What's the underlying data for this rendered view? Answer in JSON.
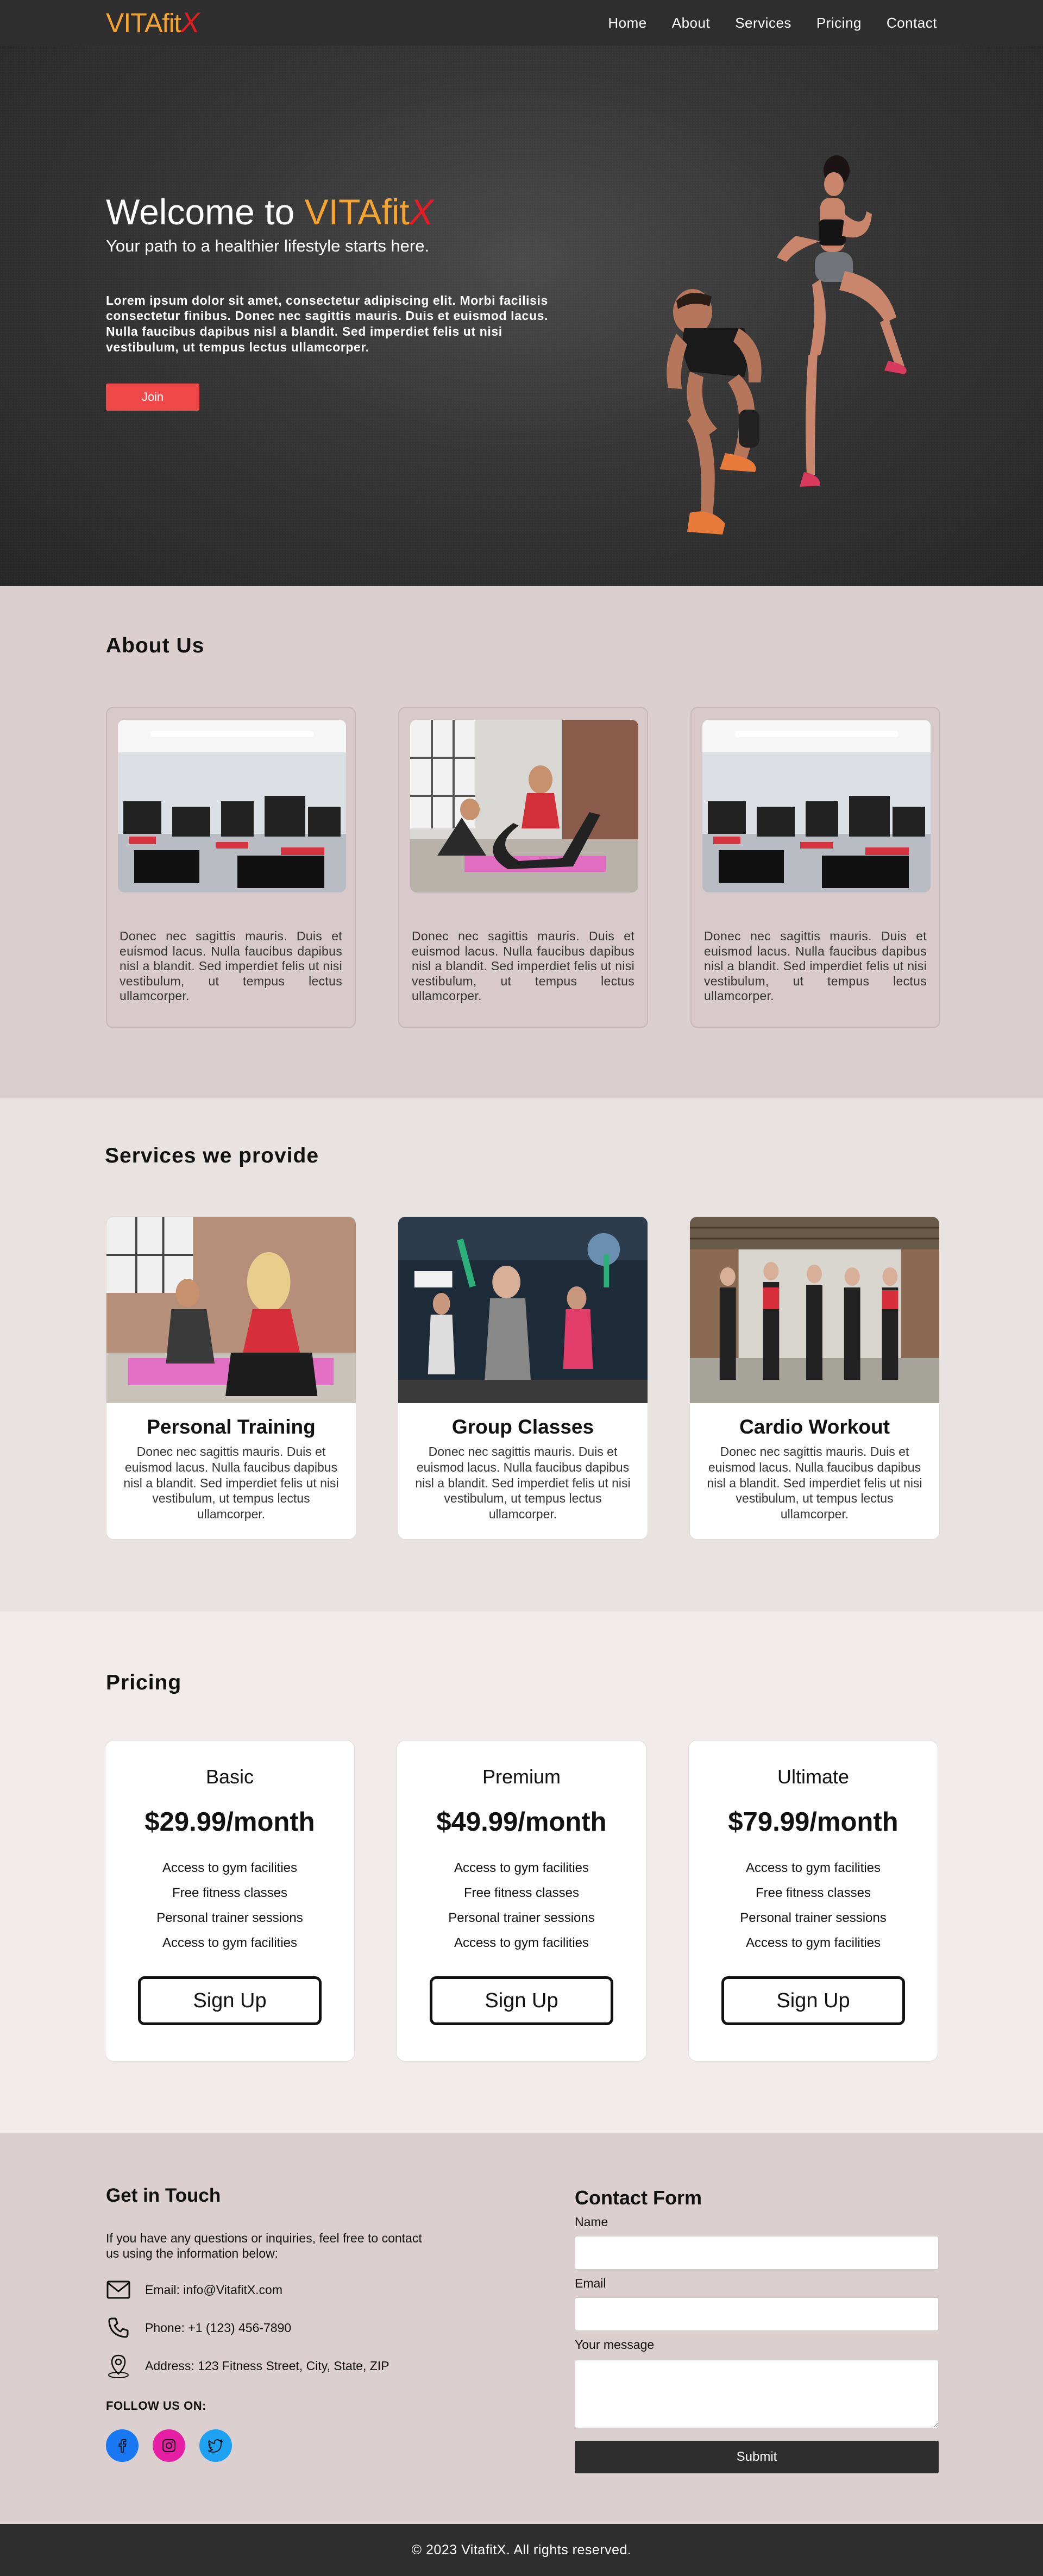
{
  "nav": {
    "logo_vita": "VITA",
    "logo_fit": "fit",
    "logo_x": "X",
    "links": [
      "Home",
      "About",
      "Services",
      "Pricing",
      "Contact"
    ]
  },
  "hero": {
    "title_prefix": "Welcome to",
    "title_vita": "VITA",
    "title_fit": "fit",
    "title_x": "X",
    "subtitle": "Your path to a healthier lifestyle starts here.",
    "body": "Lorem ipsum dolor sit amet, consectetur adipiscing elit. Morbi facilisis consectetur finibus. Donec nec sagittis mauris. Duis et euismod lacus. Nulla faucibus dapibus nisl a blandit. Sed imperdiet felis ut nisi vestibulum, ut tempus lectus ullamcorper.",
    "join_label": "Join"
  },
  "about": {
    "title": "About Us",
    "cards": [
      {
        "text": "Donec nec sagittis mauris. Duis et euismod lacus. Nulla faucibus dapibus nisl a blandit. Sed imperdiet felis ut nisi vestibulum, ut tempus lectus ullamcorper."
      },
      {
        "text": "Donec nec sagittis mauris. Duis et euismod lacus. Nulla faucibus dapibus nisl a blandit. Sed imperdiet felis ut nisi vestibulum, ut tempus lectus ullamcorper."
      },
      {
        "text": "Donec nec sagittis mauris. Duis et euismod lacus. Nulla faucibus dapibus nisl a blandit. Sed imperdiet felis ut nisi vestibulum, ut tempus lectus ullamcorper."
      }
    ]
  },
  "services": {
    "title": "Services we provide",
    "cards": [
      {
        "name": "Personal Training",
        "desc": "Donec nec sagittis mauris. Duis et euismod lacus. Nulla faucibus dapibus nisl a blandit. Sed imperdiet felis ut nisi vestibulum, ut tempus lectus ullamcorper."
      },
      {
        "name": "Group Classes",
        "desc": "Donec nec sagittis mauris. Duis et euismod lacus. Nulla faucibus dapibus nisl a blandit. Sed imperdiet felis ut nisi vestibulum, ut tempus lectus ullamcorper."
      },
      {
        "name": "Cardio Workout",
        "desc": "Donec nec sagittis mauris. Duis et euismod lacus. Nulla faucibus dapibus nisl a blandit. Sed imperdiet felis ut nisi vestibulum, ut tempus lectus ullamcorper."
      }
    ]
  },
  "pricing": {
    "title": "Pricing",
    "plans": [
      {
        "name": "Basic",
        "price": "$29.99/month",
        "features": [
          "Access to gym facilities",
          "Free fitness classes",
          "Personal trainer sessions",
          "Access to gym facilities"
        ],
        "button": "Sign Up"
      },
      {
        "name": "Premium",
        "price": "$49.99/month",
        "features": [
          "Access to gym facilities",
          "Free fitness classes",
          "Personal trainer sessions",
          "Access to gym facilities"
        ],
        "button": "Sign Up"
      },
      {
        "name": "Ultimate",
        "price": "$79.99/month",
        "features": [
          "Access to gym facilities",
          "Free fitness classes",
          "Personal trainer sessions",
          "Access to gym facilities"
        ],
        "button": "Sign Up"
      }
    ]
  },
  "contact": {
    "title": "Get in Touch",
    "intro": "If you have any questions or inquiries, feel free to contact us using the information below:",
    "email": "Email: info@VitafitX.com",
    "phone": "Phone: +1 (123) 456-7890",
    "address": "Address: 123 Fitness Street, City, State, ZIP",
    "follow": "FOLLOW US ON:",
    "form": {
      "title": "Contact Form",
      "name_label": "Name",
      "email_label": "Email",
      "message_label": "Your message",
      "submit": "Submit"
    }
  },
  "footer": {
    "text": "© 2023 VitafitX. All rights reserved."
  },
  "colors": {
    "accent_orange": "#f6a330",
    "accent_red": "#e61c24",
    "join_button": "#f04848",
    "dark": "#2e2e2e",
    "facebook": "#1877f2",
    "instagram": "#e1306c",
    "twitter": "#1da1f2"
  },
  "icons": [
    "email-icon",
    "phone-icon",
    "location-icon",
    "facebook-icon",
    "instagram-icon",
    "twitter-icon"
  ]
}
